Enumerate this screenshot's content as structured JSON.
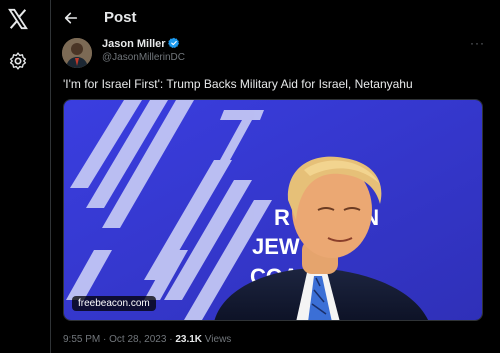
{
  "nav": {
    "logo_icon": "x-logo-icon",
    "settings_icon": "gear-icon"
  },
  "header": {
    "back_icon": "arrow-left-icon",
    "title": "Post"
  },
  "post": {
    "author_name": "Jason Miller",
    "author_handle": "@JasonMillerinDC",
    "verified_icon": "verified-badge-icon",
    "more_label": "···",
    "text": "'I'm for Israel First': Trump Backs Military Aid for Israel, Netanyahu",
    "media_source": "freebeacon.com",
    "time": "9:55 PM",
    "separator": "·",
    "date": "Oct 28, 2023",
    "views_count": "23.1K",
    "views_label": "Views"
  },
  "media_backdrop": {
    "text_line_1": "R      BLICAN",
    "text_line_2": "JEW",
    "text_line_3": "COA"
  },
  "colors": {
    "background": "#000000",
    "text_primary": "#e7e9ea",
    "text_secondary": "#71767b",
    "verified_blue": "#1d9bf0",
    "backdrop_blue": "#3b3fd6"
  }
}
